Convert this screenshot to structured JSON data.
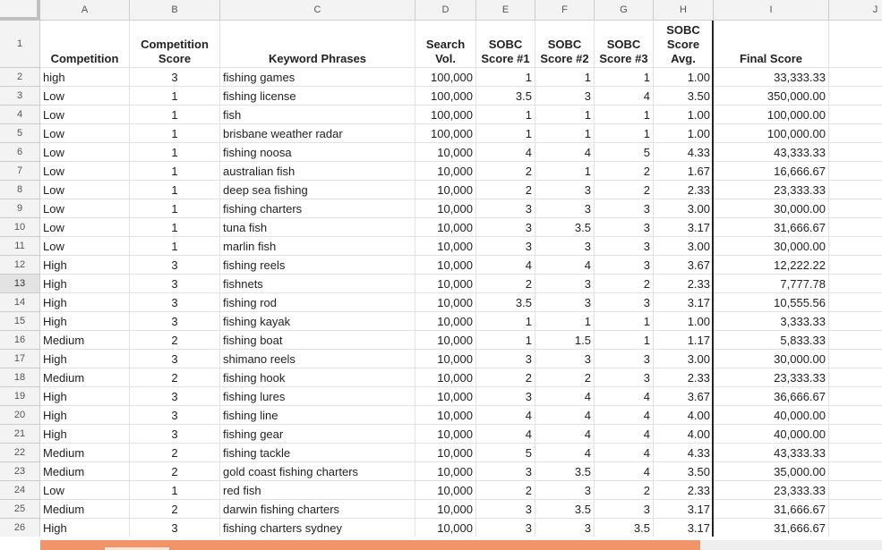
{
  "columns": [
    "A",
    "B",
    "C",
    "D",
    "E",
    "F",
    "G",
    "H",
    "I",
    "J"
  ],
  "header_row": {
    "number": "1",
    "cells": [
      "Competition",
      "Competition\nScore",
      "Keyword Phrases",
      "Search\nVol.",
      "SOBC\nScore #1",
      "SOBC\nScore #2",
      "SOBC\nScore #3",
      "SOBC\nScore\nAvg.",
      "Final Score",
      ""
    ]
  },
  "rows": [
    {
      "n": "2",
      "cells": [
        "high",
        "3",
        "fishing games",
        "100,000",
        "1",
        "1",
        "1",
        "1.00",
        "33,333.33"
      ]
    },
    {
      "n": "3",
      "cells": [
        "Low",
        "1",
        "fishing license",
        "100,000",
        "3.5",
        "3",
        "4",
        "3.50",
        "350,000.00"
      ]
    },
    {
      "n": "4",
      "cells": [
        "Low",
        "1",
        "fish",
        "100,000",
        "1",
        "1",
        "1",
        "1.00",
        "100,000.00"
      ]
    },
    {
      "n": "5",
      "cells": [
        "Low",
        "1",
        "brisbane weather radar",
        "100,000",
        "1",
        "1",
        "1",
        "1.00",
        "100,000.00"
      ]
    },
    {
      "n": "6",
      "cells": [
        "Low",
        "1",
        "fishing noosa",
        "10,000",
        "4",
        "4",
        "5",
        "4.33",
        "43,333.33"
      ]
    },
    {
      "n": "7",
      "cells": [
        "Low",
        "1",
        "australian fish",
        "10,000",
        "2",
        "1",
        "2",
        "1.67",
        "16,666.67"
      ]
    },
    {
      "n": "8",
      "cells": [
        "Low",
        "1",
        "deep sea fishing",
        "10,000",
        "2",
        "3",
        "2",
        "2.33",
        "23,333.33"
      ]
    },
    {
      "n": "9",
      "cells": [
        "Low",
        "1",
        "fishing charters",
        "10,000",
        "3",
        "3",
        "3",
        "3.00",
        "30,000.00"
      ]
    },
    {
      "n": "10",
      "cells": [
        "Low",
        "1",
        "tuna fish",
        "10,000",
        "3",
        "3.5",
        "3",
        "3.17",
        "31,666.67"
      ]
    },
    {
      "n": "11",
      "cells": [
        "Low",
        "1",
        "marlin fish",
        "10,000",
        "3",
        "3",
        "3",
        "3.00",
        "30,000.00"
      ]
    },
    {
      "n": "12",
      "cells": [
        "High",
        "3",
        "fishing reels",
        "10,000",
        "4",
        "4",
        "3",
        "3.67",
        "12,222.22"
      ]
    },
    {
      "n": "13",
      "cells": [
        "High",
        "3",
        "fishnets",
        "10,000",
        "2",
        "3",
        "2",
        "2.33",
        "7,777.78"
      ]
    },
    {
      "n": "14",
      "cells": [
        "High",
        "3",
        "fishing rod",
        "10,000",
        "3.5",
        "3",
        "3",
        "3.17",
        "10,555.56"
      ]
    },
    {
      "n": "15",
      "cells": [
        "High",
        "3",
        "fishing kayak",
        "10,000",
        "1",
        "1",
        "1",
        "1.00",
        "3,333.33"
      ]
    },
    {
      "n": "16",
      "cells": [
        "Medium",
        "2",
        "fishing boat",
        "10,000",
        "1",
        "1.5",
        "1",
        "1.17",
        "5,833.33"
      ]
    },
    {
      "n": "17",
      "cells": [
        "High",
        "3",
        "shimano reels",
        "10,000",
        "3",
        "3",
        "3",
        "3.00",
        "30,000.00"
      ]
    },
    {
      "n": "18",
      "cells": [
        "Medium",
        "2",
        "fishing hook",
        "10,000",
        "2",
        "2",
        "3",
        "2.33",
        "23,333.33"
      ]
    },
    {
      "n": "19",
      "cells": [
        "High",
        "3",
        "fishing lures",
        "10,000",
        "3",
        "4",
        "4",
        "3.67",
        "36,666.67"
      ]
    },
    {
      "n": "20",
      "cells": [
        "High",
        "3",
        "fishing line",
        "10,000",
        "4",
        "4",
        "4",
        "4.00",
        "40,000.00"
      ]
    },
    {
      "n": "21",
      "cells": [
        "High",
        "3",
        "fishing gear",
        "10,000",
        "4",
        "4",
        "4",
        "4.00",
        "40,000.00"
      ]
    },
    {
      "n": "22",
      "cells": [
        "Medium",
        "2",
        "fishing tackle",
        "10,000",
        "5",
        "4",
        "4",
        "4.33",
        "43,333.33"
      ]
    },
    {
      "n": "23",
      "cells": [
        "Medium",
        "2",
        "gold coast fishing charters",
        "10,000",
        "3",
        "3.5",
        "4",
        "3.50",
        "35,000.00"
      ]
    },
    {
      "n": "24",
      "cells": [
        "Low",
        "1",
        "red fish",
        "10,000",
        "2",
        "3",
        "2",
        "2.33",
        "23,333.33"
      ]
    },
    {
      "n": "25",
      "cells": [
        "Medium",
        "2",
        "darwin fishing charters",
        "10,000",
        "3",
        "3.5",
        "3",
        "3.17",
        "31,666.67"
      ]
    },
    {
      "n": "26",
      "cells": [
        "High",
        "3",
        "fishing charters sydney",
        "10,000",
        "3",
        "3",
        "3.5",
        "3.17",
        "31,666.67"
      ]
    }
  ],
  "selected_row": "13",
  "colors": {
    "scrollbar": "#f0956a",
    "header_bg": "#f3f3f3",
    "gridline": "#e2e2e2"
  }
}
